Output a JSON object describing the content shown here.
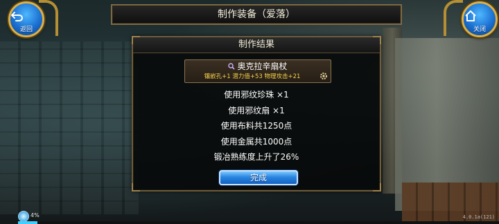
{
  "window": {
    "title": "制作装备（爱落）"
  },
  "buttons": {
    "back_label": "返回",
    "close_label": "关闭"
  },
  "dialog": {
    "title": "制作结果",
    "item": {
      "name": "奥克拉辛扇杖",
      "stats": "镶嵌孔+1 潜力值+53 物理攻击+21"
    },
    "lines": [
      "使用邪纹珍珠 ×1",
      "使用邪纹扇 ×1",
      "使用布料共1250点",
      "使用金属共1000点",
      "锻冶熟练度上升了26%"
    ],
    "done_label": "完成"
  },
  "status": {
    "percent_text": "4%",
    "progress": 0.04,
    "version": "4.0.1a(121)"
  },
  "colors": {
    "gold_border": "#7c6a45",
    "stat_yellow": "#f4d24a",
    "button_blue": "#2a86e0"
  }
}
